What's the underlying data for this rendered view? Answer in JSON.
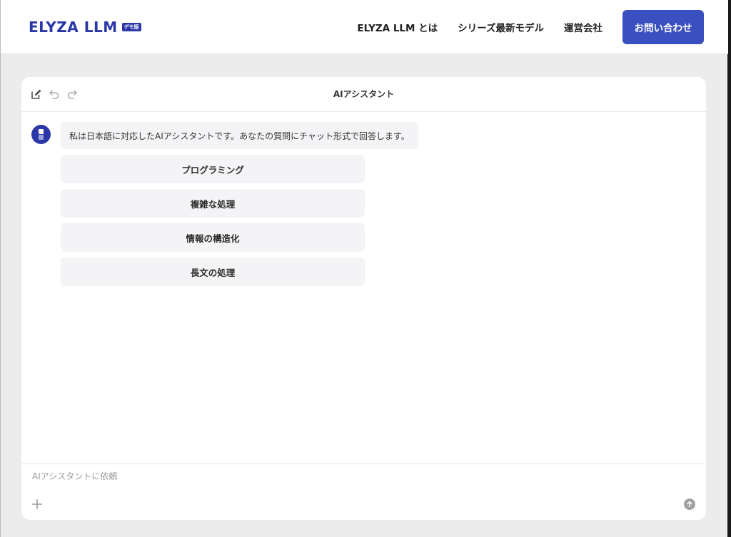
{
  "header": {
    "logo": "ELYZA LLM",
    "badge": "デモ版",
    "nav": [
      {
        "label": "ELYZA LLM とは"
      },
      {
        "label": "シリーズ最新モデル"
      },
      {
        "label": "運営会社"
      }
    ],
    "contact_label": "お問い合わせ"
  },
  "chat": {
    "title": "AIアシスタント",
    "tools": [
      "edit-icon",
      "undo-icon",
      "redo-icon"
    ],
    "assistant_message": "私は日本語に対応したAIアシスタントです。あなたの質問にチャット形式で回答します。",
    "suggestions": [
      {
        "label": "プログラミング"
      },
      {
        "label": "複雑な処理"
      },
      {
        "label": "情報の構造化"
      },
      {
        "label": "長文の処理"
      }
    ],
    "input": {
      "placeholder": "AIアシスタントに依頼",
      "value": ""
    }
  },
  "colors": {
    "brand": "#2b37a6",
    "button": "#3a4fc0",
    "background": "#ececec",
    "bubble": "#f4f4f6"
  }
}
